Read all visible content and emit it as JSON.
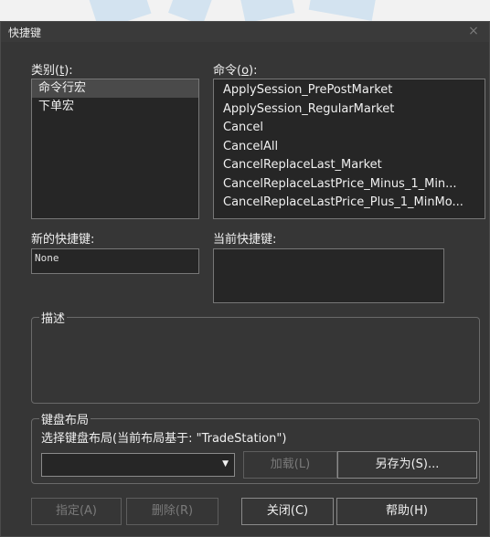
{
  "dialog": {
    "title": "快捷键",
    "close_glyph": "×"
  },
  "categories": {
    "label_prefix": "类别(",
    "label_key": "t",
    "label_suffix": "):",
    "items": [
      "命令行宏",
      "下单宏"
    ],
    "selected_index": 0
  },
  "commands": {
    "label_prefix": "命令(",
    "label_key": "o",
    "label_suffix": "):",
    "items": [
      "ApplySession_PrePostMarket",
      "ApplySession_RegularMarket",
      "Cancel",
      "CancelAll",
      "CancelReplaceLast_Market",
      "CancelReplaceLastPrice_Minus_1_Min...",
      "CancelReplaceLastPrice_Plus_1_MinMo..."
    ]
  },
  "new_shortcut": {
    "label": "新的快捷键:",
    "value": "None"
  },
  "current_shortcut": {
    "label": "当前快捷键:"
  },
  "description": {
    "title": "描述"
  },
  "keyboard_layout": {
    "title": "键盘布局",
    "select_label": "选择键盘布局(当前布局基于: \"TradeStation\")",
    "load_button": "加载(L)",
    "save_as_button": "另存为(S)..."
  },
  "buttons": {
    "assign": "指定(A)",
    "delete": "删除(R)",
    "close": "关闭(C)",
    "help": "帮助(H)"
  },
  "colors": {
    "background": "#363636",
    "listbox": "#262626",
    "selected": "#4a4a4a",
    "disabled_text": "#7a7a7a"
  }
}
